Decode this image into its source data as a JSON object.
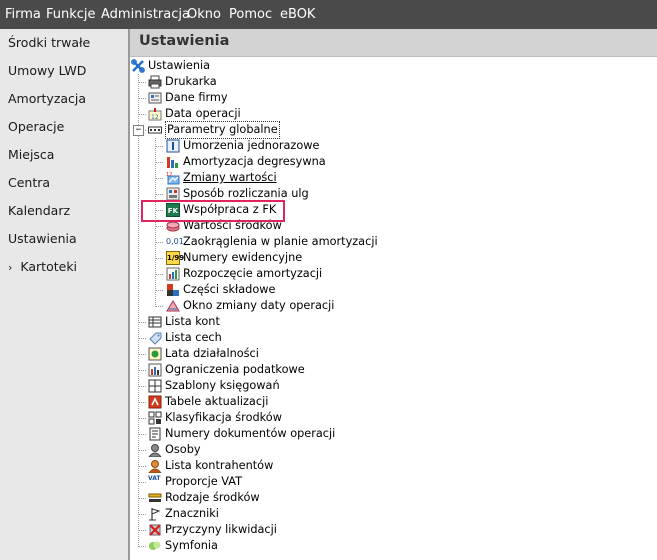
{
  "menubar": {
    "items": [
      "Firma",
      "Funkcje",
      "Administracja",
      "Okno",
      "Pomoc",
      "eBOK"
    ]
  },
  "sidebar": {
    "items": [
      "Środki trwałe",
      "Umowy LWD",
      "Amortyzacja",
      "Operacje",
      "Miejsca",
      "Centra",
      "Kalendarz",
      "Ustawienia",
      "Kartoteki"
    ],
    "expand_arrow": "›"
  },
  "header": {
    "title": "Ustawienia"
  },
  "tree": {
    "root": "Ustawienia",
    "items": [
      {
        "label": "Drukarka",
        "icon": "printer-icon"
      },
      {
        "label": "Dane firmy",
        "icon": "company-data-icon"
      },
      {
        "label": "Data operacji",
        "icon": "operation-date-icon"
      },
      {
        "label": "Parametry globalne",
        "icon": "global-parameters-icon",
        "expanded": true,
        "children": [
          {
            "label": "Umorzenia jednorazowe",
            "icon": "one-time-depreciation-icon"
          },
          {
            "label": "Amortyzacja degresywna",
            "icon": "declining-balance-icon"
          },
          {
            "label": "Zmiany wartości",
            "icon": "value-changes-icon"
          },
          {
            "label": "Sposób rozliczania ulg",
            "icon": "relief-settlement-icon"
          },
          {
            "label": "Współpraca z FK",
            "icon": "fk-cooperation-icon",
            "highlighted": true
          },
          {
            "label": "Wartości środków",
            "icon": "asset-values-icon"
          },
          {
            "label": "Zaokrąglenia w planie amortyzacji",
            "icon": "rounding-icon",
            "icon_text": "0,01"
          },
          {
            "label": "Numery ewidencyjne",
            "icon": "registry-numbers-icon",
            "icon_text": "1/99"
          },
          {
            "label": "Rozpoczęcie amortyzacji",
            "icon": "depreciation-start-icon"
          },
          {
            "label": "Części składowe",
            "icon": "components-icon"
          },
          {
            "label": "Okno zmiany daty operacji",
            "icon": "date-change-window-icon"
          }
        ]
      },
      {
        "label": "Lista kont",
        "icon": "accounts-list-icon"
      },
      {
        "label": "Lista cech",
        "icon": "features-list-icon"
      },
      {
        "label": "Lata działalności",
        "icon": "business-years-icon"
      },
      {
        "label": "Ograniczenia podatkowe",
        "icon": "tax-limits-icon"
      },
      {
        "label": "Szablony księgowań",
        "icon": "posting-templates-icon"
      },
      {
        "label": "Tabele aktualizacji",
        "icon": "update-tables-icon"
      },
      {
        "label": "Klasyfikacja środków",
        "icon": "asset-classification-icon"
      },
      {
        "label": "Numery dokumentów operacji",
        "icon": "document-numbers-icon"
      },
      {
        "label": "Osoby",
        "icon": "persons-icon"
      },
      {
        "label": "Lista kontrahentów",
        "icon": "contractors-icon"
      },
      {
        "label": "Proporcje VAT",
        "icon": "vat-proportions-icon",
        "icon_text": "VAT"
      },
      {
        "label": "Rodzaje środków",
        "icon": "asset-types-icon"
      },
      {
        "label": "Znaczniki",
        "icon": "flags-icon"
      },
      {
        "label": "Przyczyny likwidacji",
        "icon": "liquidation-reasons-icon"
      },
      {
        "label": "Symfonia",
        "icon": "symfonia-icon"
      }
    ],
    "expander_symbol": "−"
  },
  "colors": {
    "menubar": "#4a4a4a",
    "sidebar": "#e8e8e8",
    "header": "#d3d3d3",
    "highlight": "#e0245e"
  }
}
